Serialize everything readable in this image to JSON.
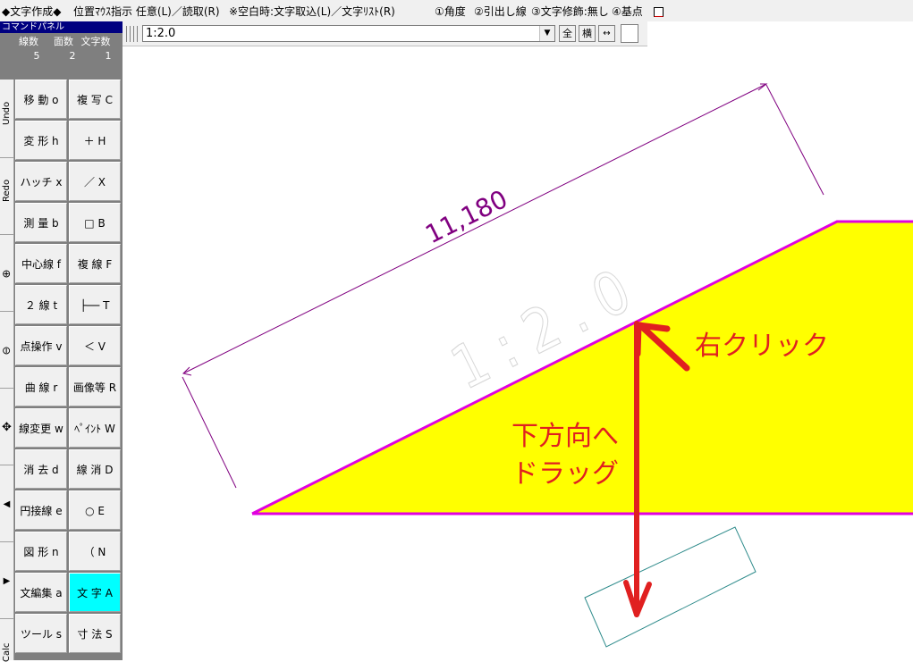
{
  "status": {
    "mode": "◆文字作成◆",
    "hint": "位置ﾏｳｽ指示 任意(L)／読取(R)",
    "hint2": "※空白時:文字取込(L)／文字ﾘｽﾄ(R)",
    "opt1": "①角度",
    "opt2": "②引出し線",
    "opt3": "③文字修飾:無し",
    "opt4": "④基点"
  },
  "panel": {
    "title": "コマンドパネル",
    "counts": [
      {
        "label": "線数",
        "value": "5"
      },
      {
        "label": "面数",
        "value": "2"
      },
      {
        "label": "文字数",
        "value": "1"
      }
    ]
  },
  "side_tabs": [
    "Undo",
    "Redo",
    "⊕",
    "⊖",
    "✥",
    "◀",
    "▶",
    "Calc"
  ],
  "commands": [
    {
      "label": "移 動 o"
    },
    {
      "label": "複 写 C"
    },
    {
      "label": "変 形 h"
    },
    {
      "label": "＋ H"
    },
    {
      "label": "ハッチ x"
    },
    {
      "label": "／ X"
    },
    {
      "label": "測 量 b"
    },
    {
      "label": "□ B"
    },
    {
      "label": "中心線 f"
    },
    {
      "label": "複 線 F"
    },
    {
      "label": "２ 線 t"
    },
    {
      "label": "├── T"
    },
    {
      "label": "点操作 v"
    },
    {
      "label": "＜ V"
    },
    {
      "label": "曲 線 r"
    },
    {
      "label": "画像等 R"
    },
    {
      "label": "線変更 w"
    },
    {
      "label": "ﾍﾟｲﾝﾄ W"
    },
    {
      "label": "消 去 d"
    },
    {
      "label": "線 消 D"
    },
    {
      "label": "円接線 e"
    },
    {
      "label": "○ E"
    },
    {
      "label": "図 形 n"
    },
    {
      "label": "（ N"
    },
    {
      "label": "文編集 a"
    },
    {
      "label": "文 字 A",
      "active": true
    },
    {
      "label": "ツール s"
    },
    {
      "label": "寸 法 S"
    }
  ],
  "toolbar": {
    "text_value": "1:2.0",
    "btn_all": "全",
    "btn_horizontal": "横",
    "btn_spacing": "↔"
  },
  "drawing": {
    "dimension_text": "11,180",
    "slope_text": "1:2.0",
    "instruction_right_click": "右クリック",
    "instruction_drag_line1": "下方向へ",
    "instruction_drag_line2": "ドラッグ",
    "colors": {
      "fill": "#ffff00",
      "outline": "#e000e0",
      "dimension": "#800080",
      "arrow": "#e02020",
      "ghost_text": "#d8d8d8",
      "preview_box": "#2e8b8b"
    }
  }
}
